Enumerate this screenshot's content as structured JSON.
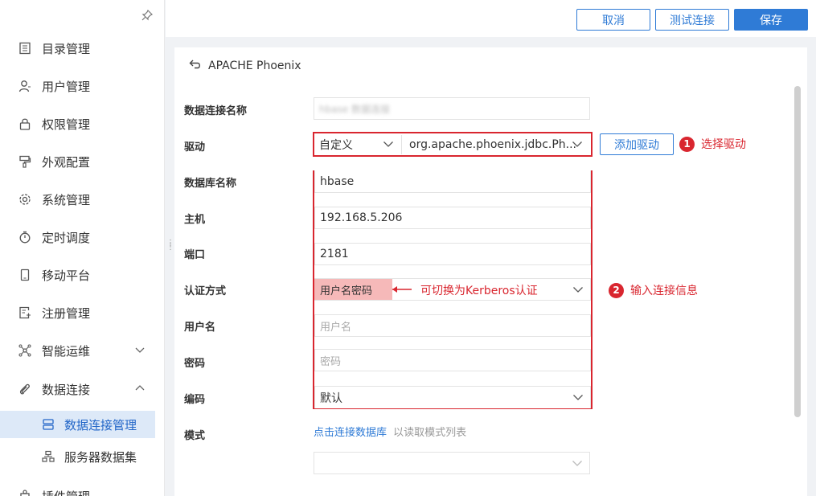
{
  "sidebar": {
    "items": [
      {
        "label": "目录管理",
        "icon": "catalog-icon"
      },
      {
        "label": "用户管理",
        "icon": "user-icon"
      },
      {
        "label": "权限管理",
        "icon": "lock-icon"
      },
      {
        "label": "外观配置",
        "icon": "brush-icon"
      },
      {
        "label": "系统管理",
        "icon": "gear-icon"
      },
      {
        "label": "定时调度",
        "icon": "timer-icon"
      },
      {
        "label": "移动平台",
        "icon": "mobile-icon"
      },
      {
        "label": "注册管理",
        "icon": "register-icon"
      },
      {
        "label": "智能运维",
        "icon": "ops-icon"
      },
      {
        "label": "数据连接",
        "icon": "link-icon"
      },
      {
        "label": "插件管理",
        "icon": "plugin-icon"
      }
    ],
    "sub_items": [
      {
        "label": "数据连接管理",
        "icon": "database-icon"
      },
      {
        "label": "服务器数据集",
        "icon": "server-dataset-icon"
      }
    ]
  },
  "toolbar": {
    "cancel_label": "取消",
    "test_label": "测试连接",
    "save_label": "保存"
  },
  "form": {
    "back_title": "APACHE Phoenix",
    "connection_name_label": "数据连接名称",
    "connection_name_value": "hbase 数据连接",
    "driver_label": "驱动",
    "driver_type_value": "自定义",
    "driver_class_value": "org.apache.phoenix.jdbc.Ph...",
    "add_driver_label": "添加驱动",
    "db_name_label": "数据库名称",
    "db_name_value": "hbase",
    "host_label": "主机",
    "host_value": "192.168.5.206",
    "port_label": "端口",
    "port_value": "2181",
    "auth_label": "认证方式",
    "auth_value": "用户名密码",
    "username_label": "用户名",
    "username_placeholder": "用户名",
    "password_label": "密码",
    "password_placeholder": "密码",
    "encoding_label": "编码",
    "encoding_value": "默认",
    "schema_label": "模式",
    "schema_link": "点击连接数据库",
    "schema_hint": "以读取模式列表"
  },
  "annotations": {
    "step1_number": "1",
    "step1_text": "选择驱动",
    "step2_number": "2",
    "step2_text": "输入连接信息",
    "kerberos_note": "可切换为Kerberos认证"
  },
  "colors": {
    "accent": "#2f7bd6",
    "annotation_red": "#d9262f",
    "active_bg": "#dde9f8"
  }
}
